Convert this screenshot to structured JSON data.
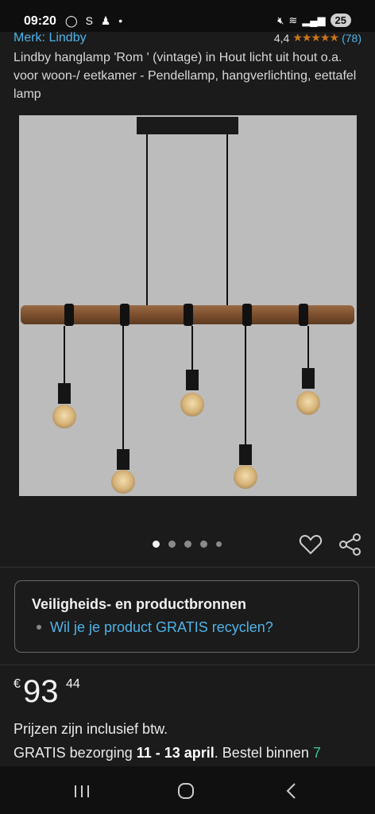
{
  "status_bar": {
    "time": "09:20",
    "battery": "25"
  },
  "brand": {
    "link": "Merk: Lindby",
    "rating": "4,4",
    "rating_count": "(78)",
    "stars_fraction": 0.88
  },
  "product": {
    "title": "Lindby hanglamp 'Rom ' (vintage) in Hout licht uit hout o.a. voor woon-/ eetkamer - Pendellamp, hangverlichting, eettafel lamp"
  },
  "carousel": {
    "total_dots": 5,
    "active_index": 0
  },
  "safety": {
    "title": "Veiligheids- en productbronnen",
    "link": "Wil je je product GRATIS recyclen?"
  },
  "price": {
    "currency": "€",
    "whole": "93",
    "fraction": "44"
  },
  "tax_note": "Prijzen zijn inclusief btw.",
  "delivery": {
    "prefix": "GRATIS bezorging ",
    "dates": "11 - 13 april",
    "suffix": ". Bestel binnen ",
    "countdown": "7"
  },
  "colors": {
    "link": "#4fb3e8",
    "star": "#c9761c",
    "countdown": "#3fbf9a"
  }
}
